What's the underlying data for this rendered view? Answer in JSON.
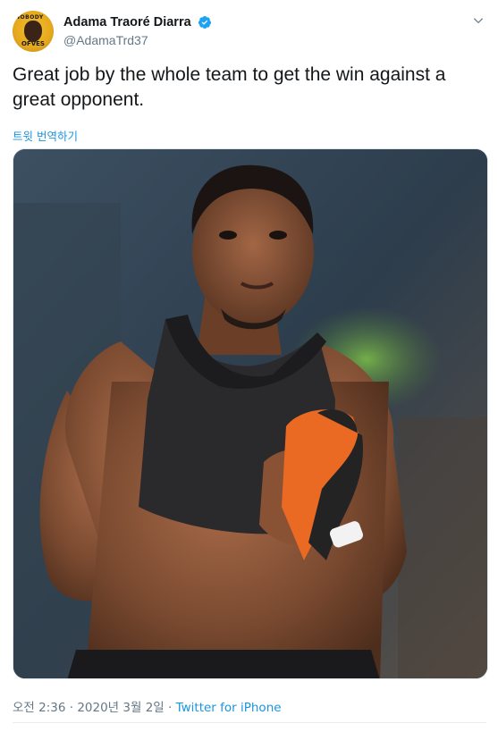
{
  "author": {
    "display_name": "Adama Traoré Diarra",
    "handle": "@AdamaTrd37",
    "verified": true,
    "avatar_icon": "profile-avatar"
  },
  "tweet": {
    "text": "Great job by the whole team to get the win against a great opponent.",
    "translate_label": "트윗 번역하기",
    "media_description_icon": "photo"
  },
  "meta": {
    "time": "오전 2:36",
    "separator1": " · ",
    "date": "2020년 3월 2일",
    "separator2": " · ",
    "source": "Twitter for iPhone"
  },
  "colors": {
    "link": "#1b95e0",
    "secondary_text": "#657786",
    "primary_text": "#14171a",
    "verified_badge": "#1da1f2"
  }
}
